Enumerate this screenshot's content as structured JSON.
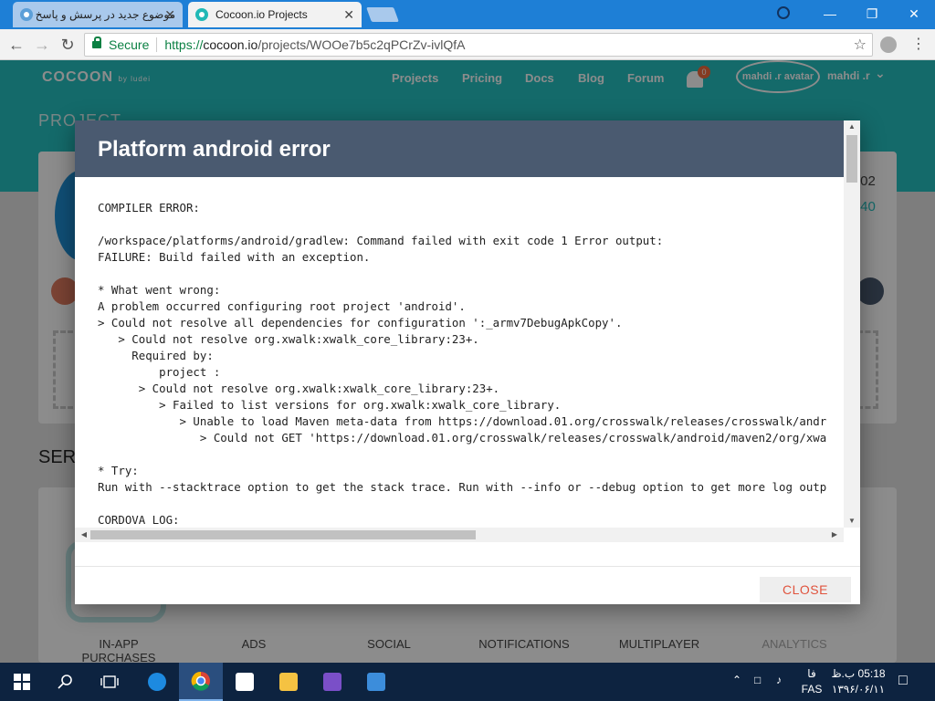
{
  "browser": {
    "tabs": [
      {
        "title": "موضوع جدید در پرسش و پاسخ",
        "active": false
      },
      {
        "title": "Cocoon.io Projects",
        "active": true
      }
    ],
    "close_glyph": "✕",
    "security_label": "Secure",
    "url_scheme": "https://",
    "url_host": "cocoon.io",
    "url_path": "/projects/WOOe7b5c2qPCrZv-ivlQfA"
  },
  "site": {
    "logo": "COCOON",
    "logo_sub": "by ludei",
    "nav": [
      "Projects",
      "Pricing",
      "Docs",
      "Blog",
      "Forum"
    ],
    "notification_count": "0",
    "avatar_alt": "mahdi .r avatar",
    "username": "mahdi .r",
    "section_project": "PROJECT",
    "section_services": "SER",
    "date_fragment": "/02",
    "time_fragment": ":40",
    "services": [
      "IN-APP PURCHASES",
      "ADS",
      "SOCIAL",
      "NOTIFICATIONS",
      "MULTIPLAYER",
      "ANALYTICS"
    ]
  },
  "modal": {
    "title": "Platform android error",
    "log": "COMPILER ERROR:\n\n/workspace/platforms/android/gradlew: Command failed with exit code 1 Error output:\nFAILURE: Build failed with an exception.\n\n* What went wrong:\nA problem occurred configuring root project 'android'.\n> Could not resolve all dependencies for configuration ':_armv7DebugApkCopy'.\n   > Could not resolve org.xwalk:xwalk_core_library:23+.\n     Required by:\n         project :\n      > Could not resolve org.xwalk:xwalk_core_library:23+.\n         > Failed to list versions for org.xwalk:xwalk_core_library.\n            > Unable to load Maven meta-data from https://download.01.org/crosswalk/releases/crosswalk/andr\n               > Could not GET 'https://download.01.org/crosswalk/releases/crosswalk/android/maven2/org/xwa\n\n* Try:\nRun with --stacktrace option to get the stack trace. Run with --info or --debug option to get more log outp\n\nCORDOVA LOG:",
    "close_label": "CLOSE"
  },
  "taskbar": {
    "clock_time": "05:18 ب.ظ",
    "clock_date": "۱۳۹۶/۰۶/۱۱",
    "lang_top": "فا",
    "lang_bottom": "FAS"
  },
  "colors": {
    "brand_teal": "#26c1c1",
    "modal_header": "#4a5a70",
    "close_text": "#e0533d",
    "chrome_blue": "#1e7fd6",
    "taskbar": "#0d2340"
  }
}
